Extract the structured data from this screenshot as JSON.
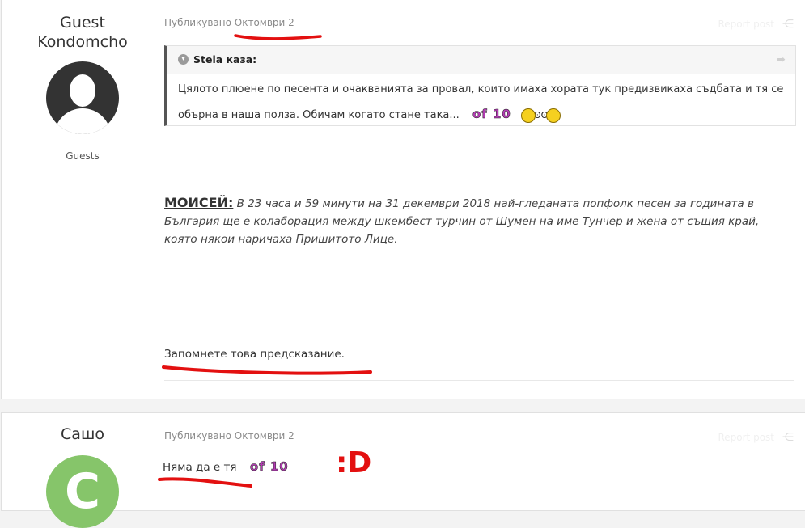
{
  "posts": [
    {
      "author": "Guest Kondomcho",
      "group": "Guests",
      "meta_prefix": "Публикувано ",
      "meta_date": "Октомври 2",
      "report": "Report post",
      "quote": {
        "author_line": "Stela каза:",
        "text": "Цялото плюене по песента и очакванията за провал, които имаха хората тук предизвикаха съдбата и тя се обърна в наша полза. Обичам когато стане така...",
        "emote": "of 10"
      },
      "prophecy_title": "МОИСЕЙ:",
      "prophecy_text": " В 23 часа и 59 минути на 31 декември 2018 най-гледаната попфолк песен за годината в България ще е колаборация между шкембест турчин от Шумен на име Тунчер и жена от същия край, която някои наричаха Пришитото Лице.",
      "remember": "Запомнете това предсказание."
    },
    {
      "author": "Сашо",
      "avatar_letter": "C",
      "meta_prefix": "Публикувано ",
      "meta_date": "Октомври 2",
      "report": "Report post",
      "text": "Няма да е тя",
      "emote": "of 10",
      "big": ":D"
    }
  ],
  "colors": {
    "annotation": "#e31010",
    "avatar_green": "#86c56a"
  }
}
